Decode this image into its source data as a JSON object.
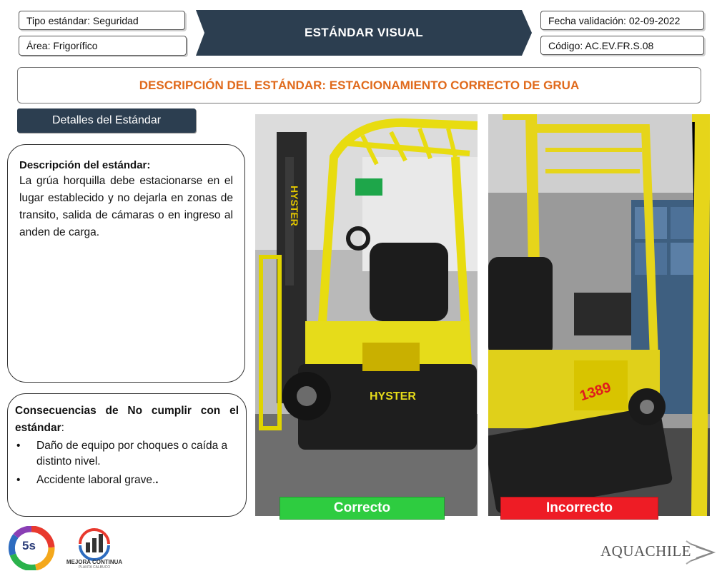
{
  "header": {
    "tipo_estandar": "Tipo estándar: Seguridad",
    "area": "Área: Frigorífico",
    "title": "ESTÁNDAR VISUAL",
    "fecha_validacion": "Fecha validación: 02-09-2022",
    "codigo": "Código: AC.EV.FR.S.08"
  },
  "description_title": "DESCRIPCIÓN DEL ESTÁNDAR: ESTACIONAMIENTO CORRECTO DE GRUA",
  "details_tab": "Detalles del Estándar",
  "description": {
    "heading": "Descripción del estándar:",
    "text": "La grúa horquilla debe estacionarse en el lugar establecido y no dejarla en zonas de transito, salida de cámaras o en ingreso al anden de carga."
  },
  "consequences": {
    "heading_bold": "Consecuencias de No cumplir con el estándar",
    "heading_suffix": ":",
    "items": [
      "Daño de equipo por choques o caída a distinto nivel.",
      "Accidente laboral grave."
    ]
  },
  "photos": {
    "left_label": "Correcto",
    "right_label": "Incorrecto",
    "left_forklift_brand": "HYSTER",
    "right_forklift_number": "1389"
  },
  "footer": {
    "logo_5s": "5s",
    "mejora_continua": "MEJORA CONTINUA",
    "mejora_sub": "PLANTA CALBUCO",
    "aquachile": "AQUACHILE"
  },
  "colors": {
    "banner": "#2c3e50",
    "accent_orange": "#e06a1c",
    "correct_green": "#2ecc40",
    "incorrect_red": "#ee1c25"
  }
}
